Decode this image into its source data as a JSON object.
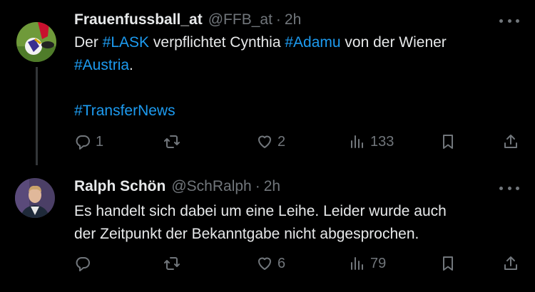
{
  "tweets": [
    {
      "name": "Frauenfussball_at",
      "handle": "@FFB_at",
      "separator": "·",
      "time": "2h",
      "text_parts": {
        "p1": "Der ",
        "tag1": "#LASK",
        "p2": " verpflichtet Cynthia ",
        "tag2": "#Adamu",
        "p3": " von der Wiener",
        "tag3": "#Austria",
        "p4": ".",
        "tag4": "#TransferNews"
      },
      "counts": {
        "replies": "1",
        "retweets": "",
        "likes": "2",
        "views": "133"
      }
    },
    {
      "name": "Ralph Schön",
      "handle": "@SchRalph",
      "separator": "·",
      "time": "2h",
      "text_lines": [
        "Es handelt sich dabei um eine Leihe. Leider wurde auch",
        "der Zeitpunkt der Bekanntgabe nicht abgesprochen."
      ],
      "counts": {
        "replies": "",
        "retweets": "",
        "likes": "6",
        "views": "79"
      }
    }
  ],
  "colors": {
    "background": "#000000",
    "text": "#e7e9ea",
    "muted": "#71767b",
    "link": "#1d9bf0",
    "thread": "#333639"
  },
  "icons": [
    "more-icon",
    "reply-icon",
    "retweet-icon",
    "like-icon",
    "views-icon",
    "bookmark-icon",
    "share-icon"
  ]
}
